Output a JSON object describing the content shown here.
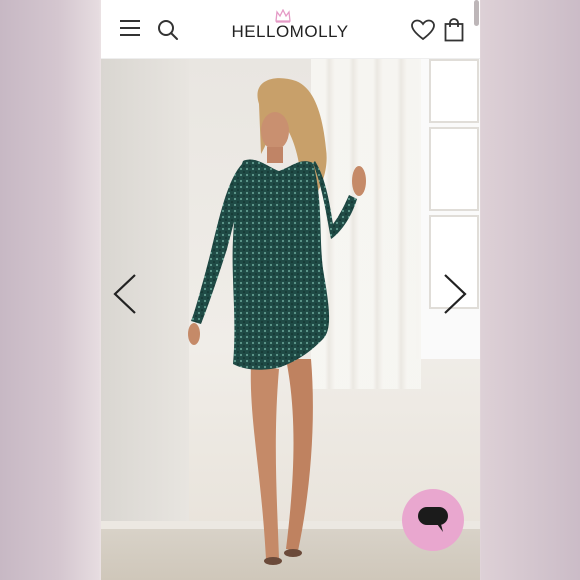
{
  "header": {
    "logo_text": "HELLOMOLLY",
    "icons": [
      "menu-icon",
      "search-icon",
      "crown-icon",
      "heart-icon",
      "shopping-bag-icon"
    ]
  },
  "carousel": {
    "prev_icon": "chevron-left-icon",
    "next_icon": "chevron-right-icon",
    "image_alt": ""
  },
  "chat": {
    "icon": "chat-bubble-icon",
    "color": "#e9a7cf"
  },
  "colors": {
    "dress": "#1f4a45",
    "background_side": "#cbbcc7"
  }
}
